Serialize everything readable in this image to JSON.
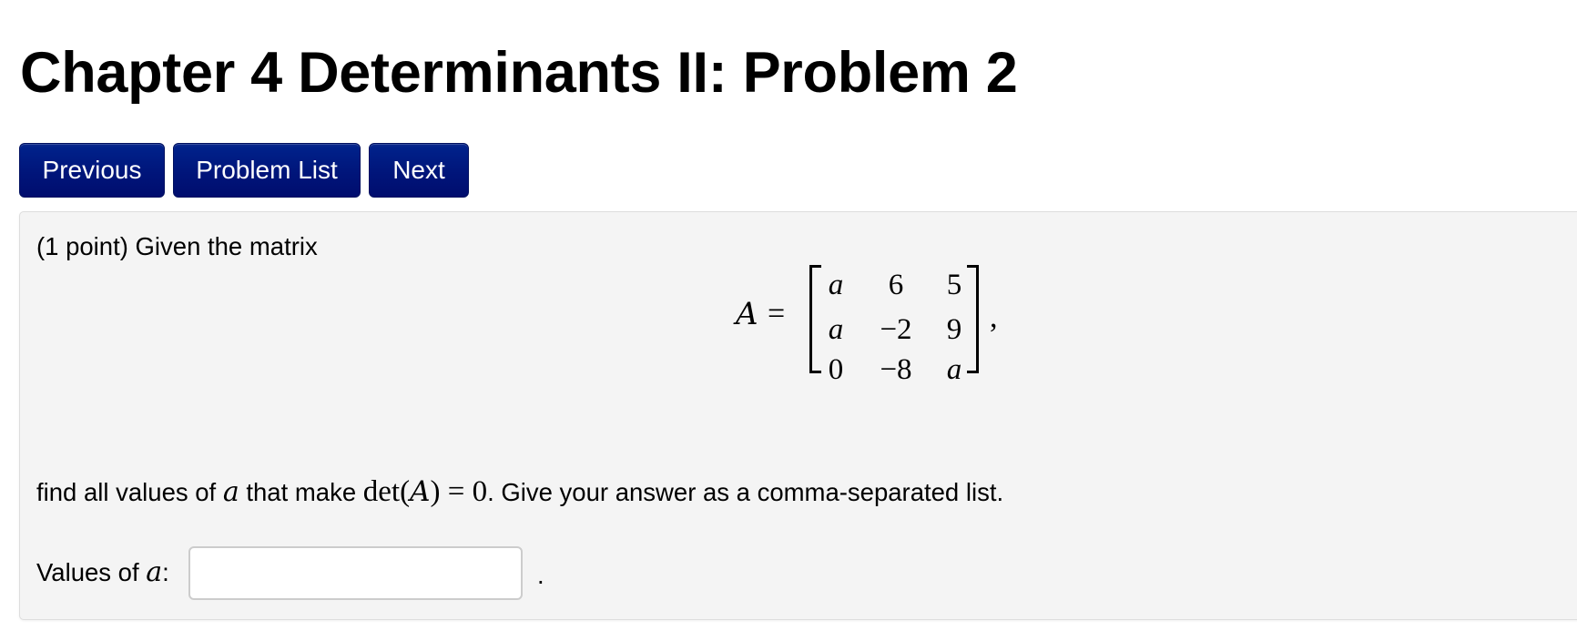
{
  "page": {
    "title": "Chapter 4 Determinants II: Problem 2"
  },
  "nav": {
    "previous_label": "Previous",
    "problem_list_label": "Problem List",
    "next_label": "Next",
    "button_color": "#00157a"
  },
  "problem": {
    "intro": "(1 point) Given the matrix",
    "matrix": {
      "name": "A",
      "equals": "=",
      "rows": [
        [
          "a",
          "6",
          "5"
        ],
        [
          "a",
          "−2",
          "9"
        ],
        [
          "0",
          "−8",
          "a"
        ]
      ],
      "trailing": ","
    },
    "question": {
      "part1": "find all values of ",
      "var": "a",
      "part2": " that make ",
      "det_expr": "det(",
      "det_arg": "A",
      "det_close": ") = 0",
      "part3": ". Give your answer as a comma-separated list."
    },
    "answer": {
      "label_prefix": "Values of ",
      "label_var": "a",
      "label_suffix": ":",
      "value": "",
      "placeholder": "",
      "trailing": "."
    }
  }
}
